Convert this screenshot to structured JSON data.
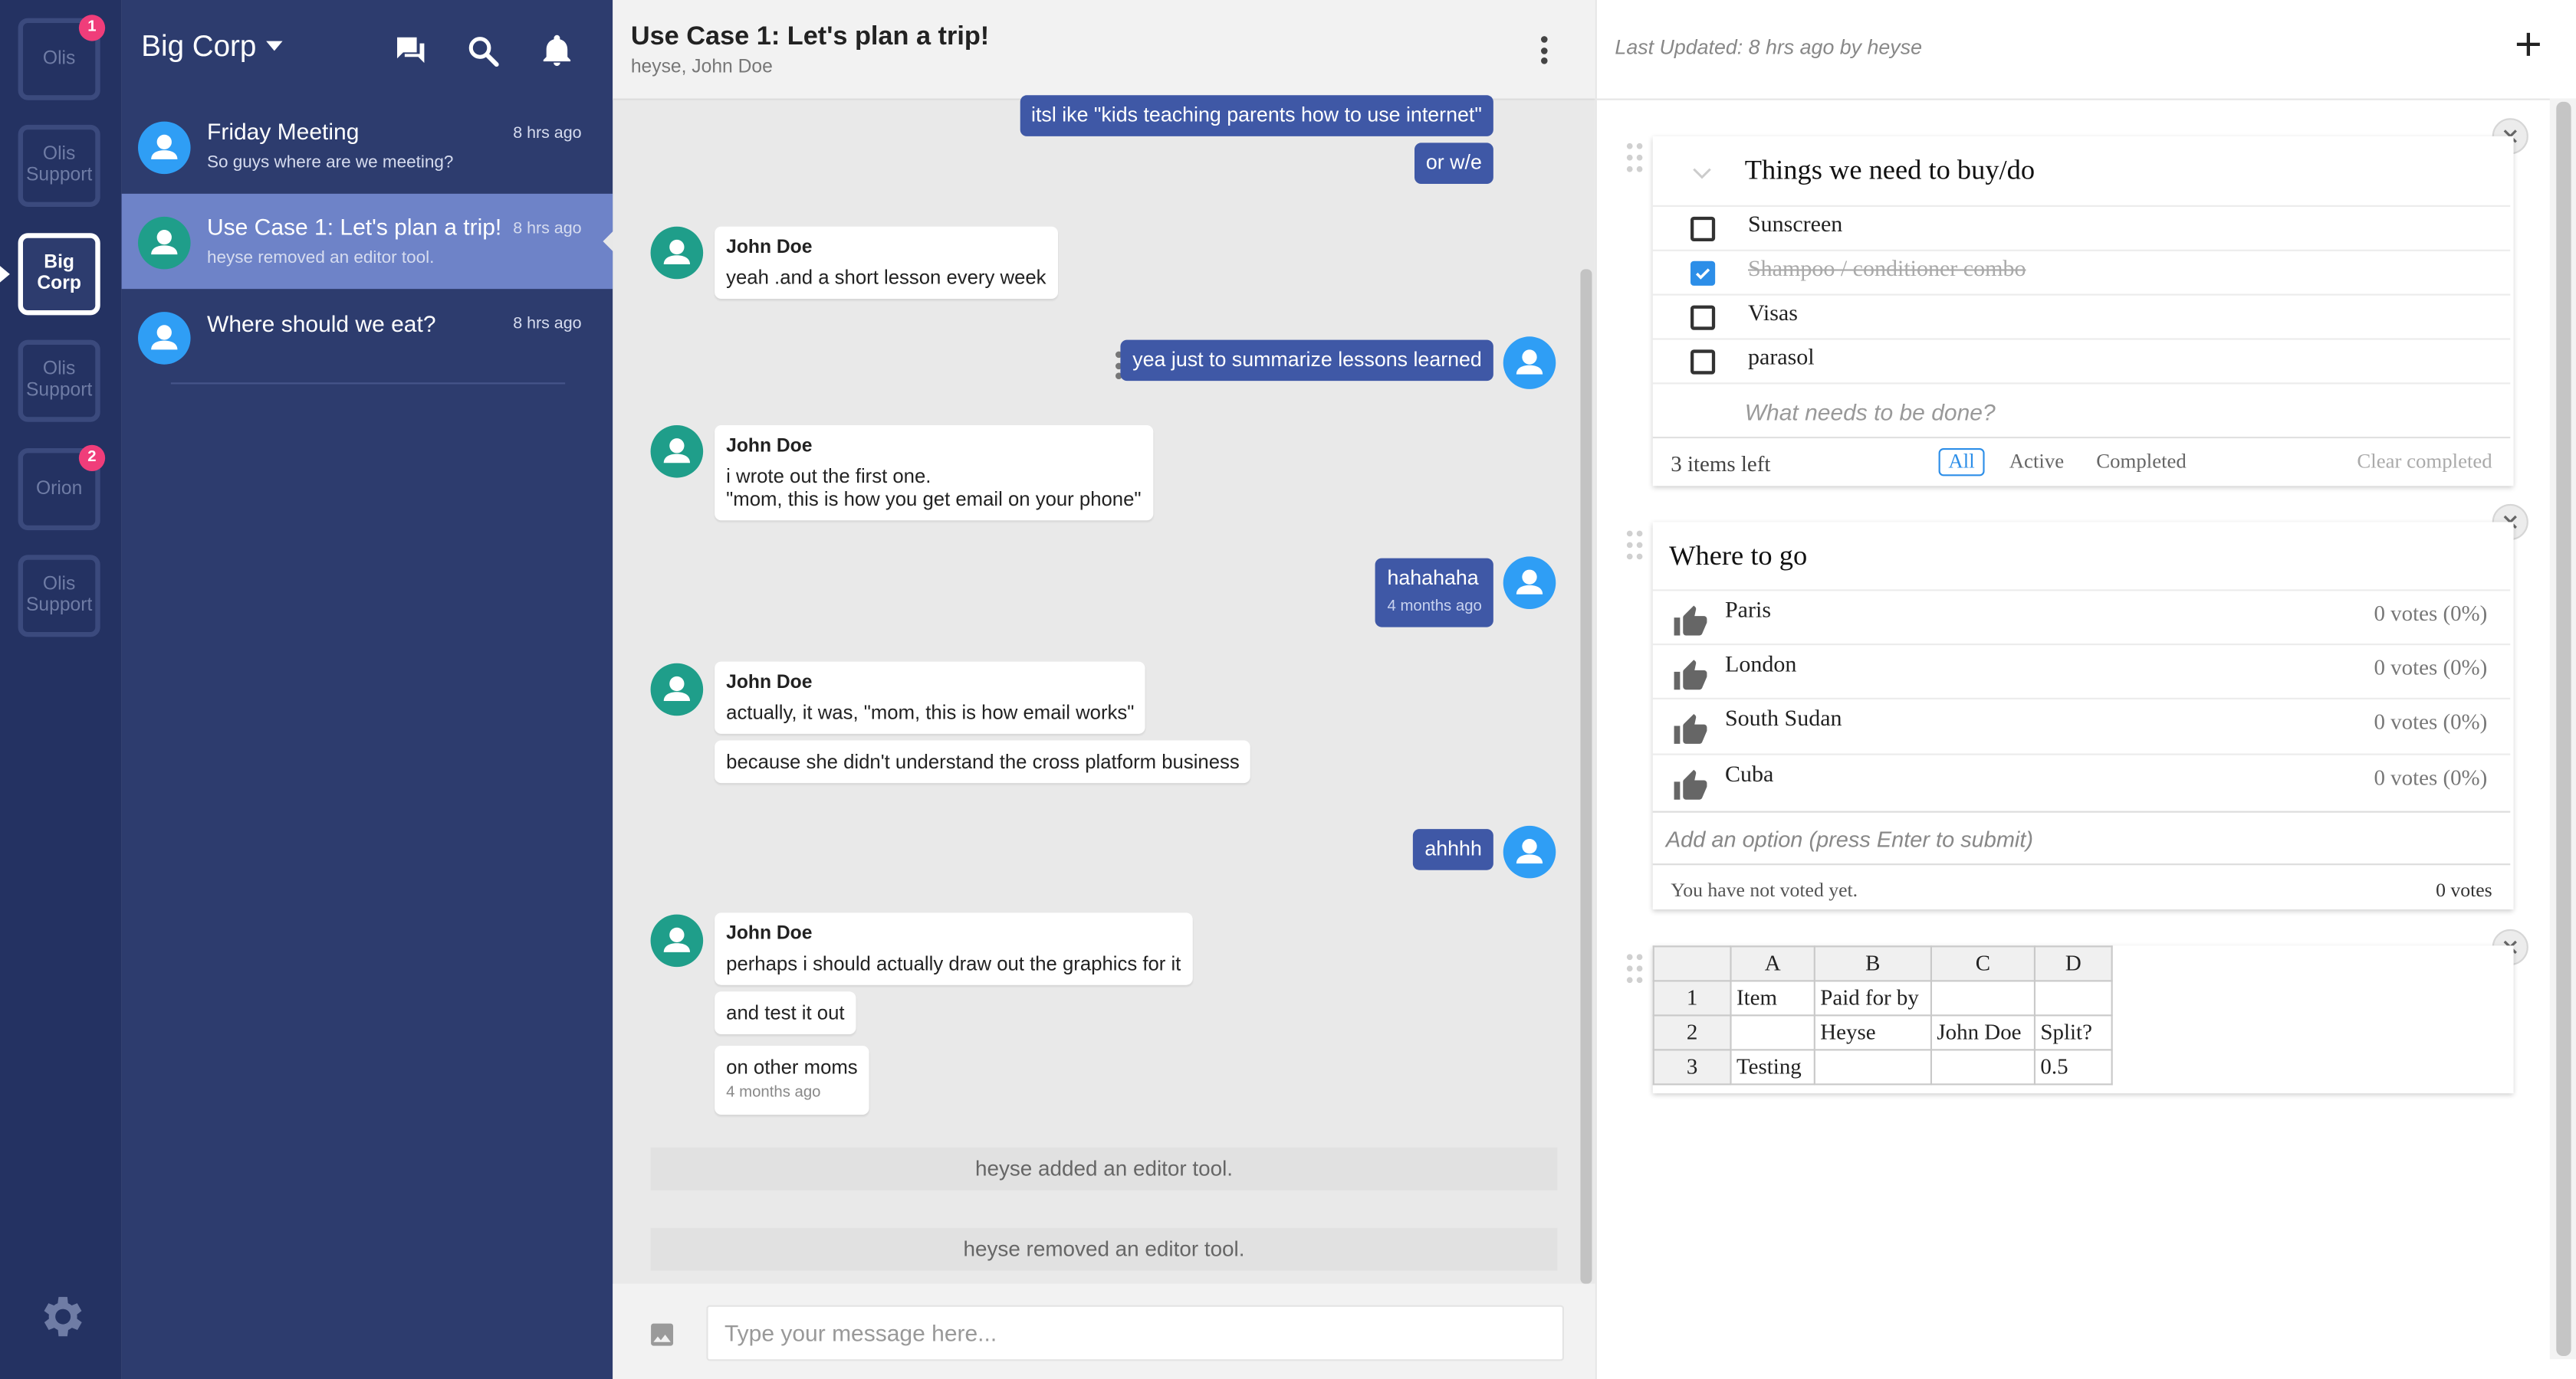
{
  "rail": {
    "orgs": [
      {
        "label": "Olis",
        "badge": "1"
      },
      {
        "label": "Olis Support",
        "badge": ""
      },
      {
        "label": "Big Corp",
        "badge": ""
      },
      {
        "label": "Olis Support",
        "badge": ""
      },
      {
        "label": "Orion",
        "badge": "2"
      },
      {
        "label": "Olis Support",
        "badge": ""
      }
    ]
  },
  "sidebar": {
    "workspace": "Big Corp",
    "conversations": [
      {
        "title": "Friday Meeting",
        "preview": "So guys where are we meeting?",
        "time": "8 hrs ago",
        "avatar_color": "#2f9ef5"
      },
      {
        "title": "Use Case 1: Let's plan a trip!",
        "preview": "heyse removed an editor tool.",
        "time": "8 hrs ago",
        "avatar_color": "#1f9e8a"
      },
      {
        "title": "Where should we eat?",
        "preview": "",
        "time": "8 hrs ago",
        "avatar_color": "#2f9ef5"
      }
    ]
  },
  "chat": {
    "title": "Use Case 1: Let's plan a trip!",
    "participants": "heyse, John Doe",
    "m1": "itsl ike \"kids teaching parents how to use internet\"",
    "m2": "or w/e",
    "m3_author": "John Doe",
    "m3": "yeah .and a short lesson every week",
    "m4": "yea just to summarize lessons learned",
    "m5_author": "John Doe",
    "m5_line1": "i wrote out the first one.",
    "m5_line2": "\"mom, this is how you get email on your phone\"",
    "m6": "hahahaha",
    "m6_time": "4 months ago",
    "m7_author": "John Doe",
    "m7": "actually, it was, \"mom, this is how email works\"",
    "m8": "because she didn't understand the cross platform business",
    "m9": "ahhhh",
    "m10_author": "John Doe",
    "m10": "perhaps i should actually draw out the graphics for it",
    "m11": "and test it out",
    "m12": "on other moms",
    "m12_time": "4 months ago",
    "sys1": "heyse added an editor tool.",
    "sys2": "heyse removed an editor tool.",
    "input_placeholder": "Type your message here..."
  },
  "panel": {
    "last_updated": "Last Updated: 8 hrs ago by heyse",
    "todo": {
      "title": "Things we need to buy/do",
      "items": [
        {
          "text": "Sunscreen",
          "done": false
        },
        {
          "text": "Shampoo / conditioner combo",
          "done": true
        },
        {
          "text": "Visas",
          "done": false
        },
        {
          "text": "parasol",
          "done": false
        }
      ],
      "new_placeholder": "What needs to be done?",
      "items_left": "3 items left",
      "filter_all": "All",
      "filter_active": "Active",
      "filter_completed": "Completed",
      "clear": "Clear completed"
    },
    "poll": {
      "title": "Where to go",
      "options": [
        {
          "name": "Paris",
          "votes": "0 votes (0%)"
        },
        {
          "name": "London",
          "votes": "0 votes (0%)"
        },
        {
          "name": "South Sudan",
          "votes": "0 votes (0%)"
        },
        {
          "name": "Cuba",
          "votes": "0 votes (0%)"
        }
      ],
      "add_placeholder": "Add an option (press Enter to submit)",
      "status": "You have not voted yet.",
      "total": "0 votes"
    },
    "sheet": {
      "columns": [
        "A",
        "B",
        "C",
        "D"
      ],
      "rows": [
        {
          "n": "1",
          "cells": [
            "Item",
            "Paid for by",
            "",
            ""
          ]
        },
        {
          "n": "2",
          "cells": [
            "",
            "Heyse",
            "John Doe",
            "Split?"
          ]
        },
        {
          "n": "3",
          "cells": [
            "Testing",
            "",
            "",
            "0.5"
          ]
        }
      ]
    }
  }
}
